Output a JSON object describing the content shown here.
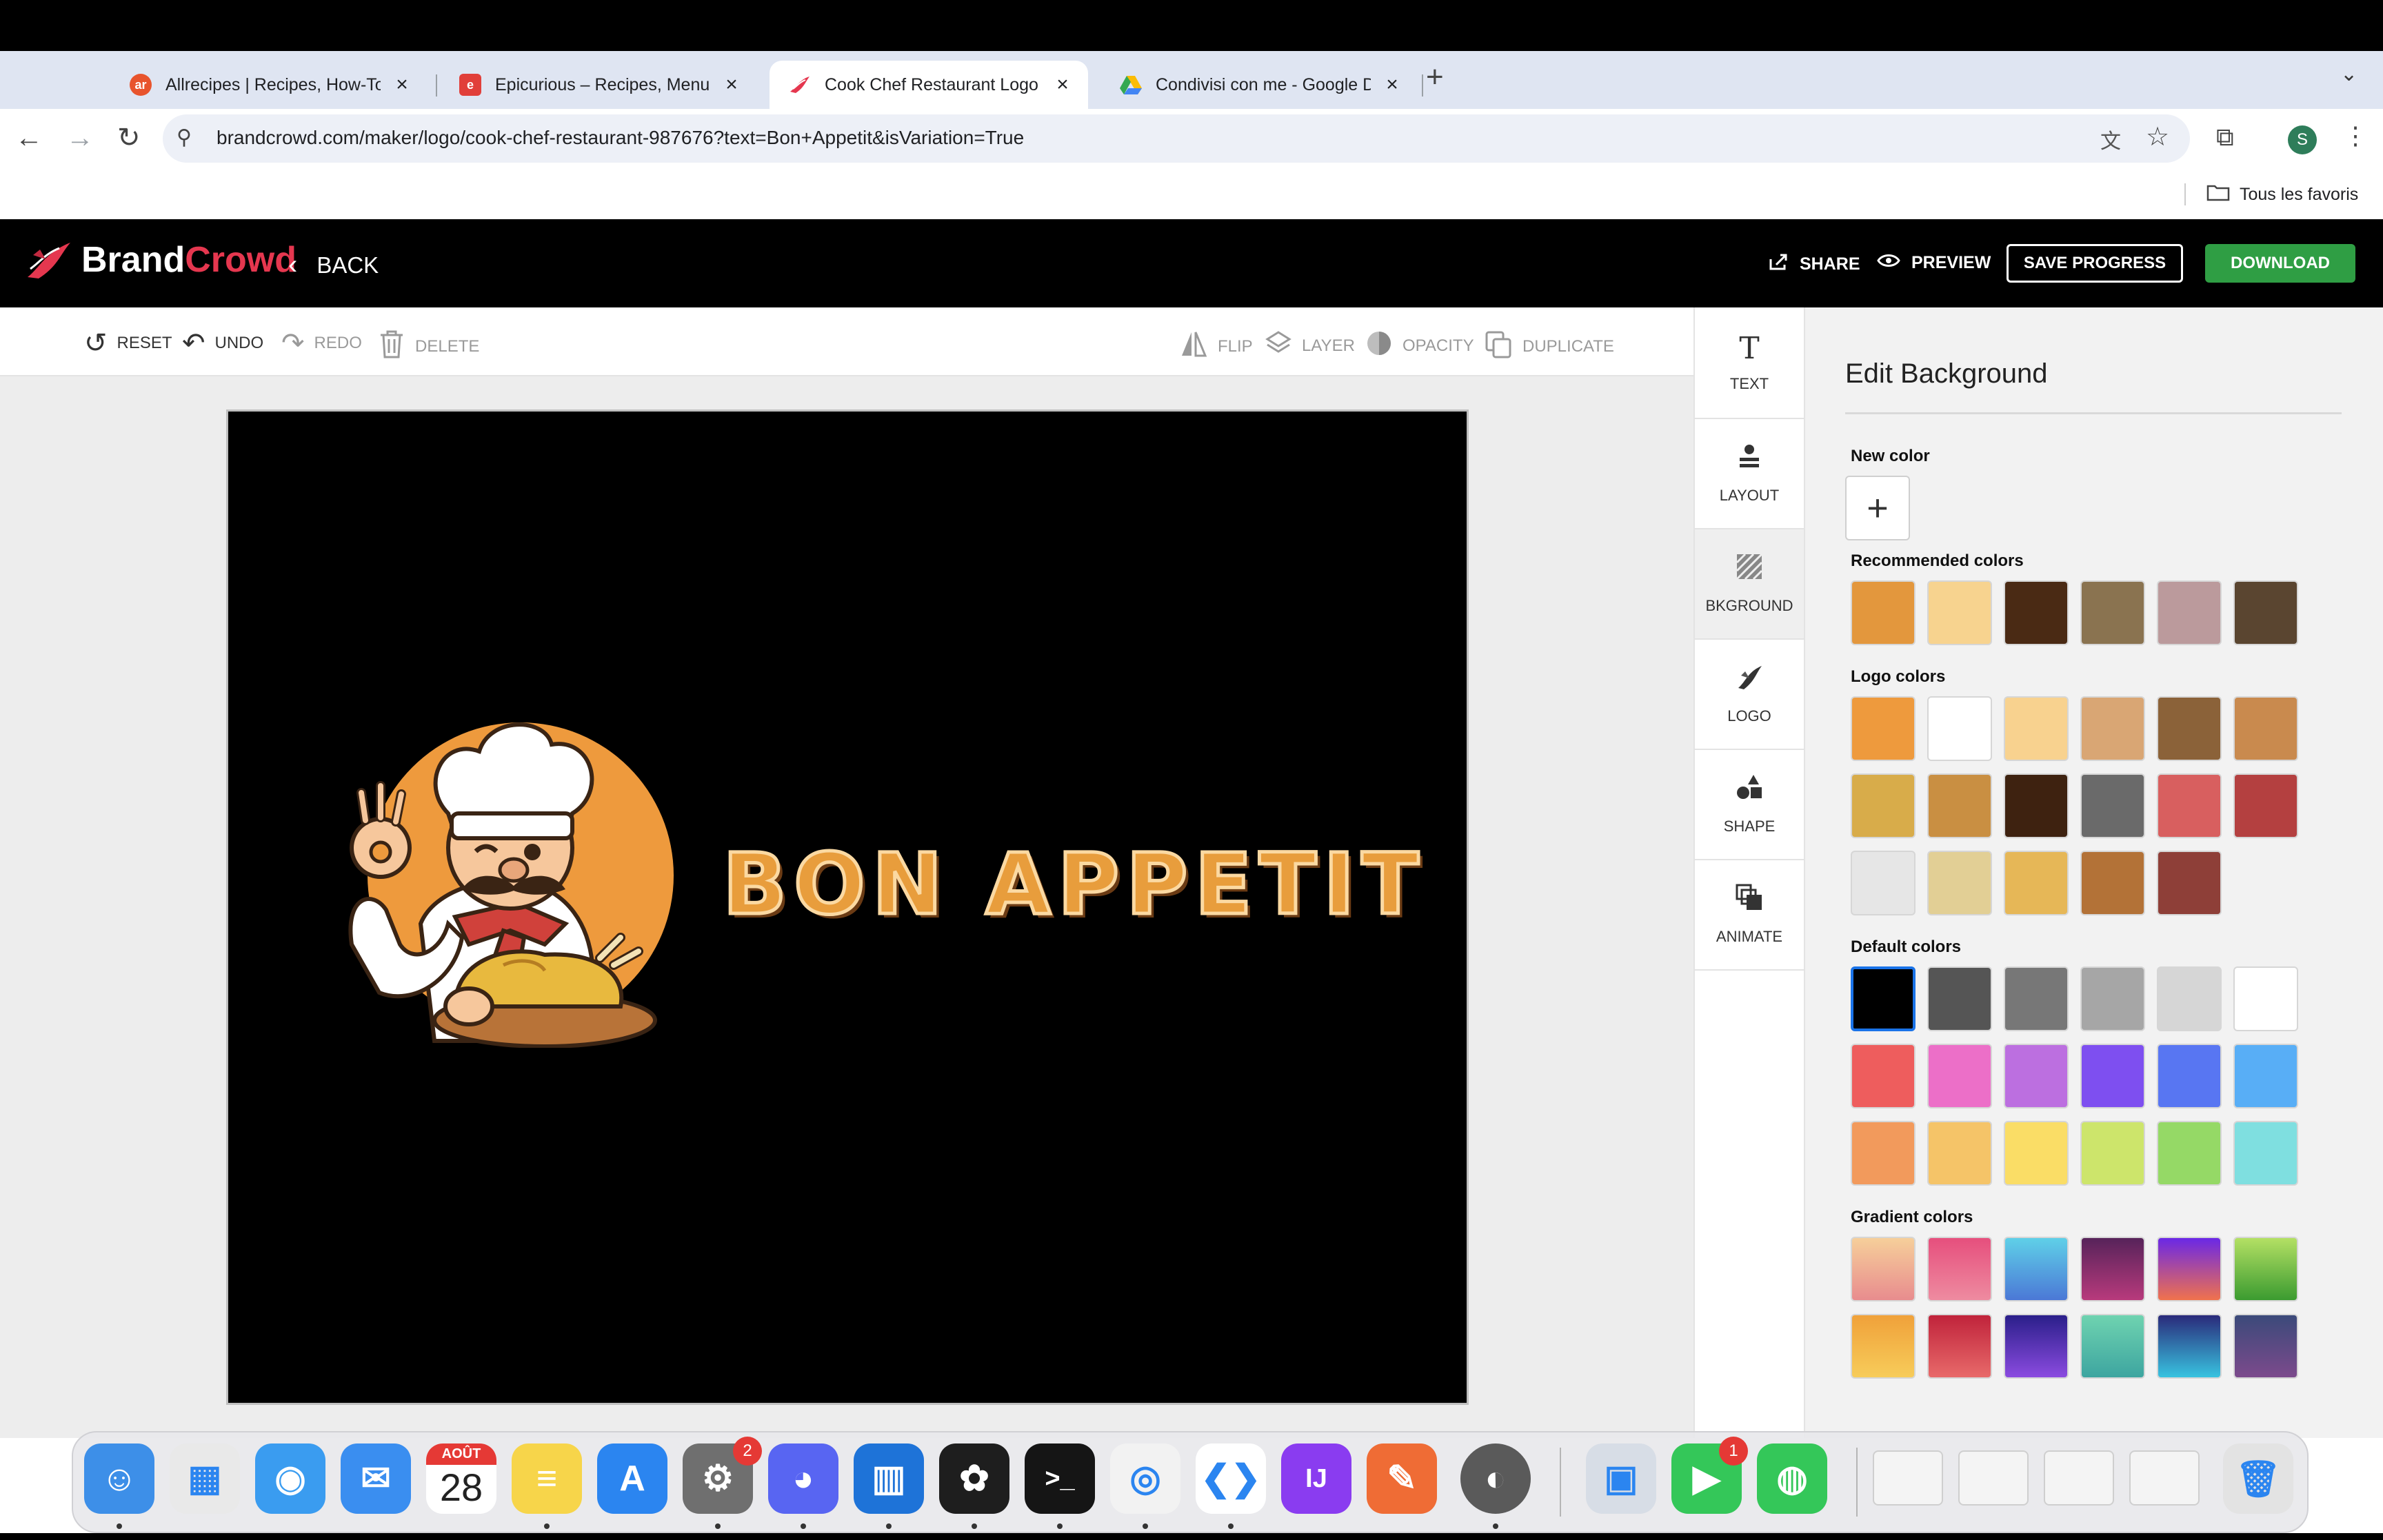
{
  "browser": {
    "tabs": [
      {
        "title": "Allrecipes | Recipes, How-Tos",
        "favicon": "allrecipes-icon",
        "favicon_text": "ar",
        "favicon_color": "#e8542d",
        "active": false
      },
      {
        "title": "Epicurious – Recipes, Menu Ideas",
        "favicon": "epicurious-icon",
        "favicon_text": "e",
        "favicon_color": "#e13f3a",
        "active": false
      },
      {
        "title": "Cook Chef Restaurant Logo | BrandCrowd",
        "favicon": "brandcrowd-icon",
        "favicon_text": "",
        "favicon_color": "#e5374f",
        "active": true
      },
      {
        "title": "Condivisi con me - Google Drive",
        "favicon": "google-drive-icon",
        "favicon_text": "",
        "favicon_color": "#34a853",
        "active": false
      }
    ],
    "url": "brandcrowd.com/maker/logo/cook-chef-restaurant-987676?text=Bon+Appetit&isVariation=True",
    "profile_initial": "S",
    "all_bookmarks": "Tous les favoris"
  },
  "header": {
    "brand_part1": "Brand",
    "brand_part2": "Crowd",
    "back": "BACK",
    "share": "SHARE",
    "preview": "PREVIEW",
    "save_progress": "SAVE PROGRESS",
    "download": "DOWNLOAD"
  },
  "edit_toolbar": {
    "reset": "RESET",
    "undo": "UNDO",
    "redo": "REDO",
    "delete": "DELETE",
    "flip": "FLIP",
    "layer": "LAYER",
    "opacity": "OPACITY",
    "duplicate": "DUPLICATE"
  },
  "canvas": {
    "logo_text": "BON APPETIT",
    "background_color": "#000000"
  },
  "side_tools": [
    {
      "label": "TEXT",
      "icon": "text-icon",
      "active": false
    },
    {
      "label": "LAYOUT",
      "icon": "layout-icon",
      "active": false
    },
    {
      "label": "BKGROUND",
      "icon": "background-icon",
      "active": true
    },
    {
      "label": "LOGO",
      "icon": "logo-icon",
      "active": false
    },
    {
      "label": "SHAPE",
      "icon": "shape-icon",
      "active": false
    },
    {
      "label": "ANIMATE",
      "icon": "animate-icon",
      "active": false
    }
  ],
  "panel": {
    "title": "Edit Background",
    "new_color_label": "New color",
    "recommended_label": "Recommended colors",
    "recommended": [
      "#e3973d",
      "#f7d38f",
      "#4a2a14",
      "#8a7350",
      "#bb9a9c",
      "#5a4530"
    ],
    "logo_label": "Logo colors",
    "logo_colors": [
      "#ee9a3d",
      "#ffffff",
      "#f8d28f",
      "#d9a674",
      "#8b6239",
      "#c98a4e",
      "#d8ac4a",
      "#c98f42",
      "#3e2210",
      "#6a6a6a",
      "#d85f5f",
      "#b44040",
      "#e6e6e6",
      "#e2cf95",
      "#e6b757",
      "#b37237",
      "#8e3f38"
    ],
    "default_label": "Default colors",
    "default_colors": [
      "#000000",
      "#555555",
      "#777777",
      "#a6a6a6",
      "#d6d6d6",
      "#ffffff",
      "#ee5d5d",
      "#ec6fc8",
      "#bc6fe0",
      "#7e4ff0",
      "#5876f2",
      "#58aef6",
      "#f29a5c",
      "#f5c468",
      "#fadd66",
      "#cde56b",
      "#95d966",
      "#7fdfe0"
    ],
    "gradient_label": "Gradient colors",
    "gradient_colors": [
      [
        "#f6cf9a",
        "#e88c8e"
      ],
      [
        "#e64f7d",
        "#ee8ba0"
      ],
      [
        "#5fd0e8",
        "#4b78d6"
      ],
      [
        "#57235a",
        "#b83a7c"
      ],
      [
        "#6a28e6",
        "#f0724d"
      ],
      [
        "#b4e064",
        "#3b9b30"
      ],
      [
        "#f0a13a",
        "#f7cc5a"
      ],
      [
        "#c0233b",
        "#e86a6a"
      ],
      [
        "#2a1f8a",
        "#8b4be0"
      ],
      [
        "#6fd3b0",
        "#3da5a0"
      ],
      [
        "#2a2a7a",
        "#38c3e0"
      ],
      [
        "#3b4a7a",
        "#7c4a8c"
      ]
    ],
    "selected_default_index": 0
  },
  "dock": {
    "apps": [
      {
        "name": "finder-icon",
        "color": "#3d8fe8",
        "glyph": "☺",
        "running": true
      },
      {
        "name": "launchpad-icon",
        "color": "#e9e9e9",
        "glyph": "▦",
        "running": false
      },
      {
        "name": "safari-icon",
        "color": "#3a9cf0",
        "glyph": "◉",
        "running": false
      },
      {
        "name": "mail-icon",
        "color": "#3a8ef0",
        "glyph": "✉",
        "running": false
      },
      {
        "name": "calendar-icon",
        "color": "#ffffff",
        "glyph": "",
        "running": false
      },
      {
        "name": "notes-icon",
        "color": "#f7d54a",
        "glyph": "≡",
        "running": true
      },
      {
        "name": "app-store-icon",
        "color": "#2b85f0",
        "glyph": "A",
        "running": false
      },
      {
        "name": "system-settings-icon",
        "color": "#6f6f6f",
        "glyph": "⚙",
        "running": true
      },
      {
        "name": "discord-icon",
        "color": "#5865f2",
        "glyph": "◕",
        "running": true
      },
      {
        "name": "trello-icon",
        "color": "#1e73d8",
        "glyph": "▥",
        "running": true
      },
      {
        "name": "figma-icon",
        "color": "#1e1e1e",
        "glyph": "✿",
        "running": true
      },
      {
        "name": "terminal-icon",
        "color": "#151515",
        "glyph": ">_",
        "running": true
      },
      {
        "name": "chrome-icon",
        "color": "#f2f2f2",
        "glyph": "◎",
        "running": true
      },
      {
        "name": "vscode-icon",
        "color": "#ffffff",
        "glyph": "❮❯",
        "running": true
      },
      {
        "name": "intellij-icon",
        "color": "#8a3cf0",
        "glyph": "IJ",
        "running": false
      },
      {
        "name": "postman-icon",
        "color": "#ef6c35",
        "glyph": "✎",
        "running": false
      },
      {
        "name": "tableplus-icon",
        "color": "#5a5a5a",
        "glyph": "◐",
        "running": true
      },
      {
        "name": "preview-icon",
        "color": "#d7dde6",
        "glyph": "▣",
        "running": false
      },
      {
        "name": "facetime-icon",
        "color": "#34c759",
        "glyph": "▶",
        "running": false
      },
      {
        "name": "messages-icon",
        "color": "#34c759",
        "glyph": "◍",
        "running": false
      },
      {
        "name": "recent-window-1",
        "color": "#f4f4f4",
        "glyph": "",
        "running": false
      },
      {
        "name": "recent-window-2",
        "color": "#f4f4f4",
        "glyph": "",
        "running": false
      },
      {
        "name": "recent-window-3",
        "color": "#f4f4f4",
        "glyph": "",
        "running": false
      },
      {
        "name": "recent-window-4",
        "color": "#f4f4f4",
        "glyph": "",
        "running": false
      },
      {
        "name": "trash-icon",
        "color": "#e3e3e3",
        "glyph": "🗑",
        "running": false
      }
    ],
    "calendar_month": "AOÛT",
    "calendar_day": "28",
    "settings_badge": "2",
    "facetime_badge": "1"
  }
}
